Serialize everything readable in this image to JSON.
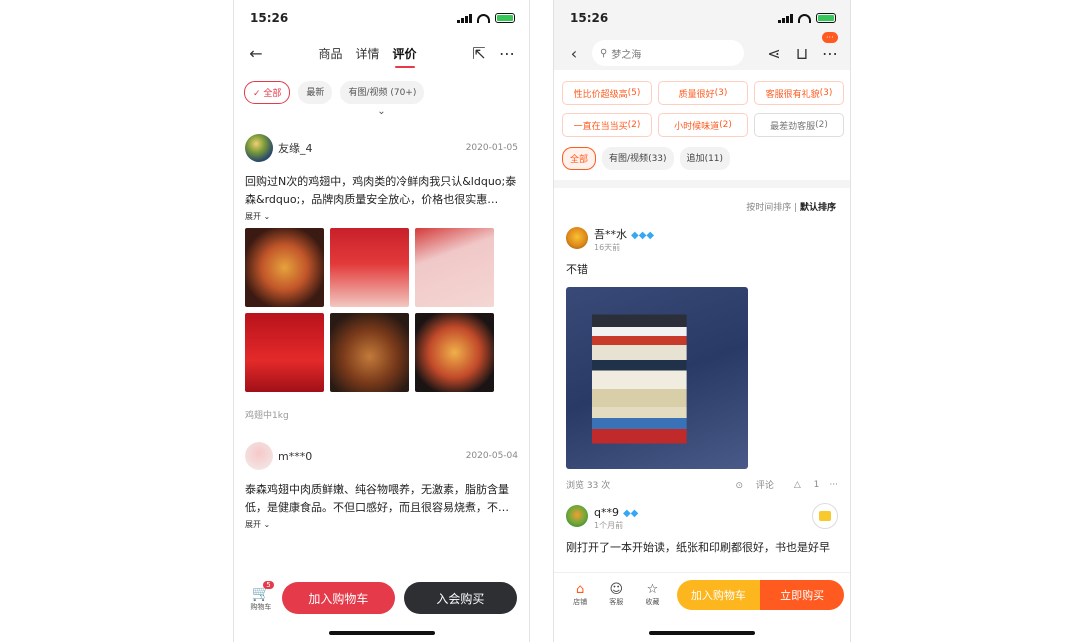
{
  "left": {
    "status_time": "15:26",
    "tabs": [
      "商品",
      "详情",
      "评价"
    ],
    "chips": [
      "全部",
      "最新",
      "有图/视频 (70+)"
    ],
    "reviews": [
      {
        "name": "友缘_4",
        "date": "2020-01-05",
        "text": "回购过N次的鸡翅中，鸡肉类的冷鲜肉我只认&ldquo;泰森&rdquo;，品牌肉质量安全放心，价格也很实惠…",
        "expand": "展开",
        "spec": "鸡翅中1kg"
      },
      {
        "name": "m***0",
        "date": "2020-05-04",
        "text": "泰森鸡翅中肉质鲜嫩、纯谷物喂养，无激素，脂肪含量低，是健康食品。不但口感好，而且很容易烧煮，不…",
        "expand": "展开"
      }
    ],
    "cart_label": "购物车",
    "cart_badge": "5",
    "add_cart": "加入购物车",
    "join_buy": "入会购买"
  },
  "right": {
    "status_time": "15:26",
    "search_placeholder": "梦之海",
    "more_badge": "···",
    "tags": [
      {
        "label": "性比价超级高",
        "count": "(5)"
      },
      {
        "label": "质量很好",
        "count": "(3)"
      },
      {
        "label": "客服很有礼貌",
        "count": "(3)"
      },
      {
        "label": "一直在当当买",
        "count": "(2)"
      },
      {
        "label": "小时候味道",
        "count": "(2)"
      },
      {
        "label": "最差劲客服",
        "count": "(2)"
      }
    ],
    "filters": [
      {
        "label": "全部",
        "count": ""
      },
      {
        "label": "有图/视频",
        "count": "(33)"
      },
      {
        "label": "追加",
        "count": "(11)"
      }
    ],
    "sort_time": "按时间排序",
    "sort_default": "默认排序",
    "review1": {
      "name": "吾**水",
      "ago": "16天前",
      "text": "不错",
      "views": "浏览 33 次",
      "comment": "评论",
      "likes": "1",
      "more": "···"
    },
    "review2": {
      "name": "q**9",
      "ago": "1个月前",
      "text": "刚打开了一本开始读，纸张和印刷都很好，书也是好早"
    },
    "bottom": {
      "shop": "店铺",
      "service": "客服",
      "fav": "收藏",
      "add_cart": "加入购物车",
      "buy_now": "立即购买"
    }
  }
}
